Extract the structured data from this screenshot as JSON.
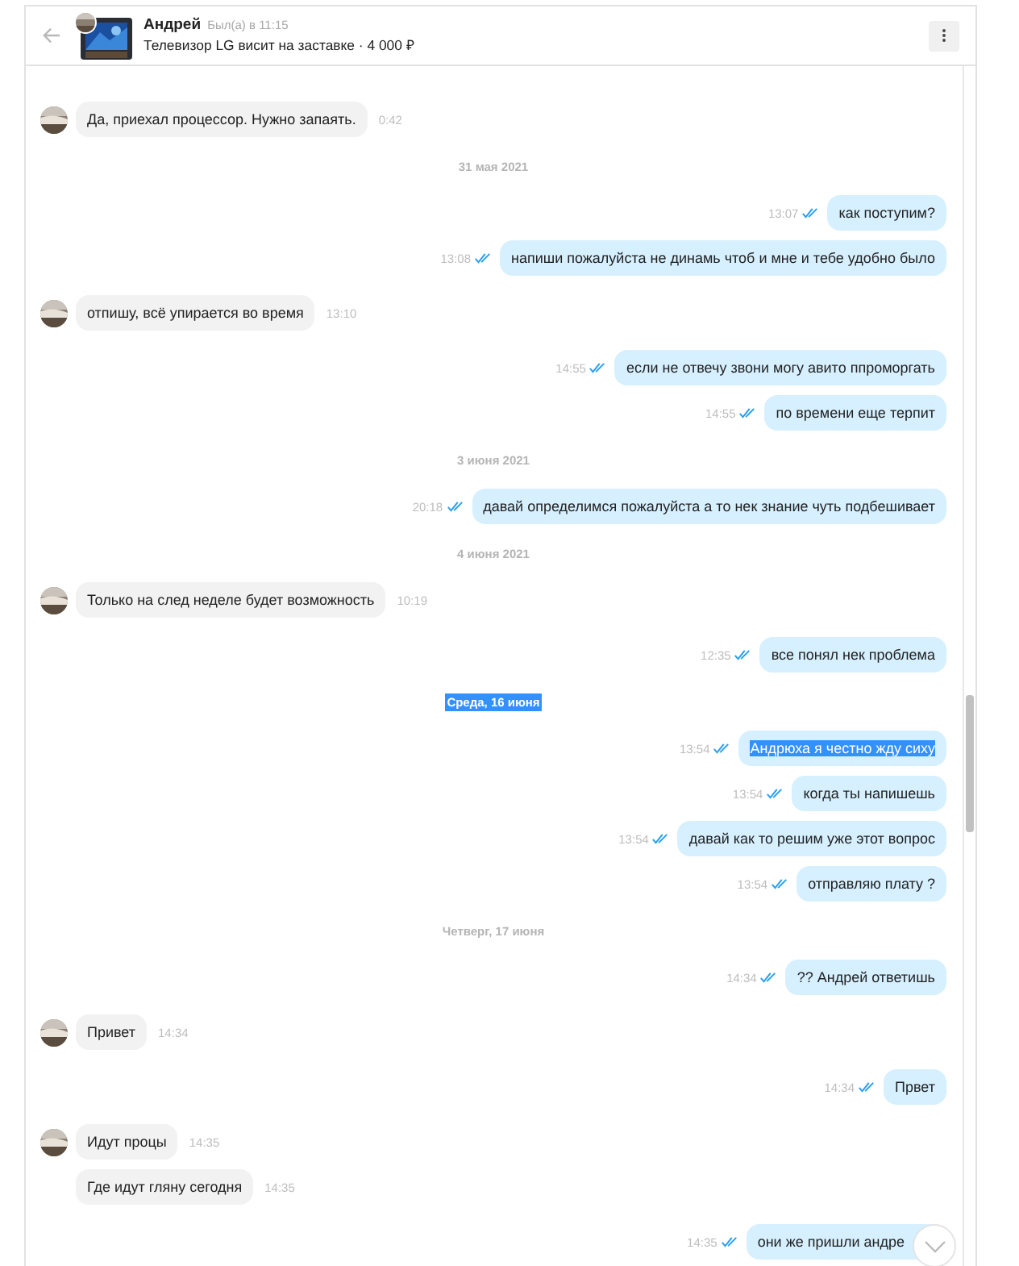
{
  "header": {
    "name": "Андрей",
    "last_seen": "Был(а) в 11:15",
    "listing": "Телевизор LG висит на заставке · 4 000 ₽"
  },
  "messages": [
    {
      "kind": "in",
      "text": "Да, приехал процессор. Нужно запаять.",
      "time": "0:42",
      "avatar": true,
      "highlighted": false
    },
    {
      "kind": "date",
      "text": "31 мая 2021",
      "highlighted": false
    },
    {
      "kind": "out",
      "text": "как поступим?",
      "time": "13:07",
      "read": true,
      "highlighted": false
    },
    {
      "kind": "out",
      "text": "напиши пожалуйста не динамь чтоб и мне и тебе удобно было",
      "time": "13:08",
      "read": true,
      "highlighted": false
    },
    {
      "kind": "in",
      "text": "отпишу, всё упирается во время",
      "time": "13:10",
      "avatar": true,
      "highlighted": false
    },
    {
      "kind": "out",
      "text": "если не отвечу звони могу авито ппроморгать",
      "time": "14:55",
      "read": true,
      "highlighted": false
    },
    {
      "kind": "out",
      "text": "по времени еще терпит",
      "time": "14:55",
      "read": true,
      "highlighted": false
    },
    {
      "kind": "date",
      "text": "3 июня 2021",
      "highlighted": false
    },
    {
      "kind": "out",
      "text": "давай определимся пожалуйста а то нек знание чуть подбешивает",
      "time": "20:18",
      "read": true,
      "highlighted": false
    },
    {
      "kind": "date",
      "text": "4 июня 2021",
      "highlighted": false
    },
    {
      "kind": "in",
      "text": "Только на след неделе будет возможность",
      "time": "10:19",
      "avatar": true,
      "highlighted": false
    },
    {
      "kind": "out",
      "text": "все понял нек проблема",
      "time": "12:35",
      "read": true,
      "highlighted": false
    },
    {
      "kind": "date",
      "text": "Среда, 16 июня",
      "highlighted": true
    },
    {
      "kind": "out",
      "text": "Андрюха я честно жду сиху",
      "time": "13:54",
      "read": true,
      "highlighted": true
    },
    {
      "kind": "out",
      "text": "когда ты напишешь",
      "time": "13:54",
      "read": true,
      "highlighted": false
    },
    {
      "kind": "out",
      "text": "давай как то решим уже этот вопрос",
      "time": "13:54",
      "read": true,
      "highlighted": false
    },
    {
      "kind": "out",
      "text": "отправляю плату ?",
      "time": "13:54",
      "read": true,
      "highlighted": false
    },
    {
      "kind": "date",
      "text": "Четверг, 17 июня",
      "highlighted": false
    },
    {
      "kind": "out",
      "text": "??  Андрей ответишь",
      "time": "14:34",
      "read": true,
      "highlighted": false
    },
    {
      "kind": "in",
      "text": "Привет",
      "time": "14:34",
      "avatar": true,
      "highlighted": false
    },
    {
      "kind": "out",
      "text": "Првет",
      "time": "14:34",
      "read": true,
      "highlighted": false
    },
    {
      "kind": "in",
      "text": "Идут процы",
      "time": "14:35",
      "avatar": true,
      "highlighted": false
    },
    {
      "kind": "in",
      "text": "Где идут гляну сегодня",
      "time": "14:35",
      "avatar": false,
      "highlighted": false
    },
    {
      "kind": "out",
      "text": "они же пришли андре",
      "time": "14:35",
      "read": true,
      "highlighted": false
    }
  ]
}
